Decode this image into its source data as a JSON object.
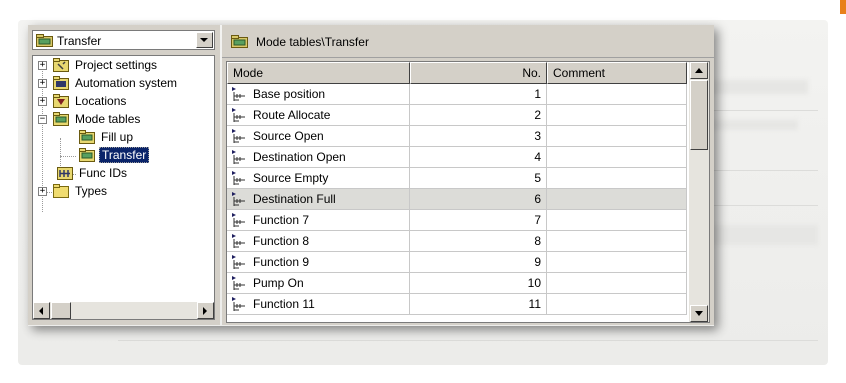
{
  "combo": {
    "value": "Transfer"
  },
  "tree": {
    "items": [
      {
        "label": "Project settings",
        "icon": "settings-folder-icon",
        "expander": "+"
      },
      {
        "label": "Automation system",
        "icon": "automation-folder-icon",
        "expander": "+"
      },
      {
        "label": "Locations",
        "icon": "locations-folder-icon",
        "expander": "+"
      },
      {
        "label": "Mode tables",
        "icon": "mode-table-folder-icon",
        "expander": "−"
      },
      {
        "label": "Fill up",
        "icon": "mode-table-icon"
      },
      {
        "label": "Transfer",
        "icon": "mode-table-icon",
        "selected": true
      },
      {
        "label": "Func IDs",
        "icon": "func-ids-icon"
      },
      {
        "label": "Types",
        "icon": "folder-icon",
        "expander": "+"
      }
    ]
  },
  "path_bar": {
    "path": "Mode tables\\Transfer"
  },
  "grid": {
    "columns": [
      "Mode",
      "No.",
      "Comment"
    ],
    "rows": [
      {
        "mode": "Base position",
        "no": "1",
        "comment": ""
      },
      {
        "mode": "Route Allocate",
        "no": "2",
        "comment": ""
      },
      {
        "mode": "Source Open",
        "no": "3",
        "comment": ""
      },
      {
        "mode": "Destination Open",
        "no": "4",
        "comment": ""
      },
      {
        "mode": "Source Empty",
        "no": "5",
        "comment": ""
      },
      {
        "mode": "Destination Full",
        "no": "6",
        "comment": "",
        "highlight": true
      },
      {
        "mode": "Function 7",
        "no": "7",
        "comment": ""
      },
      {
        "mode": "Function 8",
        "no": "8",
        "comment": ""
      },
      {
        "mode": "Function 9",
        "no": "9",
        "comment": ""
      },
      {
        "mode": "Pump On",
        "no": "10",
        "comment": ""
      },
      {
        "mode": "Function 11",
        "no": "11",
        "comment": ""
      }
    ]
  },
  "colors": {
    "window_face": "#d4d0c8",
    "selection": "#0a246a",
    "row_highlight": "#dcdcd8",
    "accent_mark": "#e8801a"
  }
}
